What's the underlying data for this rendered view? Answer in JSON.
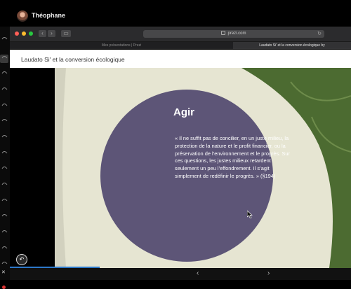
{
  "user": {
    "name": "Théophane"
  },
  "browser": {
    "url": "prezi.com",
    "tabs": [
      {
        "label": "Mes présentations | Prezi",
        "active": false
      },
      {
        "label": "Laudato Si' et la conversion écologique by",
        "active": true
      }
    ],
    "traffic_lights": [
      "#ff5f57",
      "#febc2e",
      "#28c840"
    ]
  },
  "presentation": {
    "title": "Laudato Si' et la conversion écologique",
    "slide_heading": "Agir",
    "slide_quote": "« Il ne suffit pas de concilier, en un juste milieu, la protection de la nature et le profit financier, ou la préservation de l’environnement et le progrès. Sur ces questions, les justes milieux retardent seulement un peu l’effondrement. Il s’agit simplement de redéfinir le progrès. » (§194)",
    "progress": 0.26,
    "colors": {
      "circle": "#5d5577",
      "leaf": "#4c6b31",
      "paper": "#e6e5d2",
      "accent": "#2c78c9"
    }
  },
  "controls": {
    "prev_icon": "‹",
    "next_icon": "›",
    "back_icon": "↶"
  }
}
